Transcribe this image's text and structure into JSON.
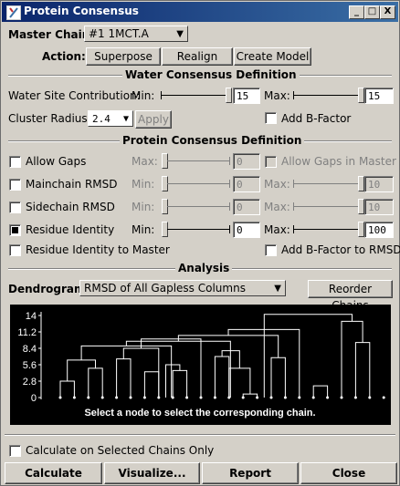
{
  "title": "Protein Consensus",
  "window_controls": {
    "minimize": "_",
    "maximize": "□",
    "close": "X"
  },
  "master_chain": {
    "label": "Master Chain:",
    "value": "#1   1MCT.A"
  },
  "action": {
    "label": "Action:",
    "superpose": "Superpose",
    "realign": "Realign",
    "create_model": "Create Model"
  },
  "water": {
    "section": "Water Consensus Definition",
    "site_label": "Water Site Contribution:",
    "min_label": "Min:",
    "min_value": "15",
    "min_level": 0.95,
    "max_label": "Max:",
    "max_value": "15",
    "max_level": 0.95,
    "cluster_label": "Cluster Radius:",
    "cluster_value": "2.4",
    "apply": "Apply",
    "add_bfactor": "Add B-Factor"
  },
  "protein": {
    "section": "Protein Consensus Definition",
    "rows": [
      {
        "label": "Allow Gaps",
        "checked": false,
        "min_label": "Max:",
        "min_value": "0",
        "min_level": 0,
        "right_label": "Allow Gaps in Master",
        "right_checked": false,
        "right_disabled": true,
        "min_disabled": true
      },
      {
        "label": "Mainchain RMSD",
        "checked": false,
        "min_label": "Min:",
        "min_value": "0",
        "min_level": 0,
        "max_label": "Max:",
        "max_value": "10",
        "max_level": 1,
        "disabled": true
      },
      {
        "label": "Sidechain RMSD",
        "checked": false,
        "min_label": "Min:",
        "min_value": "0",
        "min_level": 0,
        "max_label": "Max:",
        "max_value": "10",
        "max_level": 1,
        "disabled": true
      },
      {
        "label": "Residue Identity",
        "checked": true,
        "min_label": "Min:",
        "min_value": "0",
        "min_level": 0,
        "max_label": "Max:",
        "max_value": "100",
        "max_level": 1,
        "disabled": false
      }
    ],
    "identity_master": "Residue Identity to Master",
    "add_bfactor_rmsd": "Add B-Factor to RMSD"
  },
  "analysis": {
    "section": "Analysis",
    "dendrogram_label": "Dendrogram:",
    "dendrogram_value": "RMSD of All Gapless Columns",
    "reorder": "Reorder Chains",
    "caption": "Select a node to select the corresponding chain."
  },
  "chart_data": {
    "type": "dendrogram",
    "y_ticks": [
      "14",
      "11.2",
      "8.4",
      "5.6",
      "2.8",
      "0"
    ],
    "ylim": [
      0,
      14
    ],
    "leaves": 24,
    "merges": [
      {
        "x1": 1,
        "x2": 2,
        "h": 2.8
      },
      {
        "x1": 3,
        "x2": 4,
        "h": 5.0
      },
      {
        "x1": 1.5,
        "x2": 3.5,
        "h": 6.4
      },
      {
        "x1": 5,
        "x2": 6,
        "h": 6.6
      },
      {
        "x1": 7,
        "x2": 8,
        "h": 4.4
      },
      {
        "x1": 9,
        "x2": 10,
        "h": 4.6
      },
      {
        "x1": 8.5,
        "x2": 9.5,
        "h": 5.6
      },
      {
        "x1": 12,
        "x2": 13,
        "h": 7.0
      },
      {
        "x1": 14,
        "x2": 15,
        "h": 0.6
      },
      {
        "x1": 13,
        "x2": 14.5,
        "h": 5.0
      },
      {
        "x1": 12.5,
        "x2": 13.75,
        "h": 8.0
      },
      {
        "x1": 16,
        "x2": 17,
        "h": 6.8
      },
      {
        "x1": 19,
        "x2": 20,
        "h": 2.0
      },
      {
        "x1": 22,
        "x2": 23,
        "h": 9.4
      },
      {
        "x1": 21,
        "x2": 22.5,
        "h": 13.0
      },
      {
        "x1": 5.5,
        "x2": 8,
        "h": 8.4
      },
      {
        "x1": 6.75,
        "x2": 11,
        "h": 10.0
      },
      {
        "x1": 2.5,
        "x2": 8.9,
        "h": 8.8
      },
      {
        "x1": 5.7,
        "x2": 13.1,
        "h": 9.6
      },
      {
        "x1": 9.4,
        "x2": 16.5,
        "h": 10.6
      },
      {
        "x1": 12.95,
        "x2": 18,
        "h": 11.6
      },
      {
        "x1": 15.5,
        "x2": 21.75,
        "h": 14.2
      }
    ]
  },
  "calc_selected": "Calculate on Selected Chains Only",
  "buttons": {
    "calculate": "Calculate",
    "visualize": "Visualize...",
    "report": "Report",
    "close": "Close"
  }
}
